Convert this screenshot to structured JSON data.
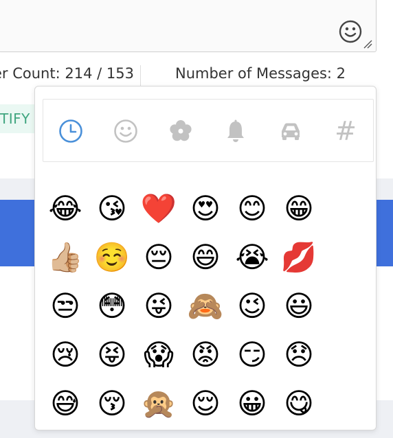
{
  "message_box": {
    "emoji_button_icon": "smiley-icon"
  },
  "status": {
    "character_count": "er Count: 214 / 153",
    "message_count": "Number of Messages: 2"
  },
  "notify_label": "TIFY",
  "colors": {
    "accent_blue": "#3f70dc",
    "active_tab": "#4a90d9",
    "inactive_tab": "#c2c2c2",
    "notify_text": "#3fa57f",
    "notify_bg": "#eaf8f3"
  },
  "emoji_picker": {
    "tabs": [
      {
        "icon": "clock-icon",
        "active": true
      },
      {
        "icon": "smiley-face-icon",
        "active": false
      },
      {
        "icon": "flower-icon",
        "active": false
      },
      {
        "icon": "bell-icon",
        "active": false
      },
      {
        "icon": "car-icon",
        "active": false
      },
      {
        "icon": "hash-icon",
        "symbol": "#",
        "active": false
      }
    ],
    "emojis": [
      [
        "😂",
        "😘",
        "❤️",
        "😍",
        "😊",
        "😁"
      ],
      [
        "👍🏼",
        "☺️",
        "😔",
        "😄",
        "😭",
        "💋"
      ],
      [
        "😒",
        "😳",
        "😜",
        "🙈",
        "😉",
        "😃"
      ],
      [
        "😢",
        "😝",
        "😱",
        "😡",
        "😏",
        "😞"
      ],
      [
        "😅",
        "😚",
        "🙊",
        "😌",
        "😀",
        "😋"
      ]
    ]
  }
}
